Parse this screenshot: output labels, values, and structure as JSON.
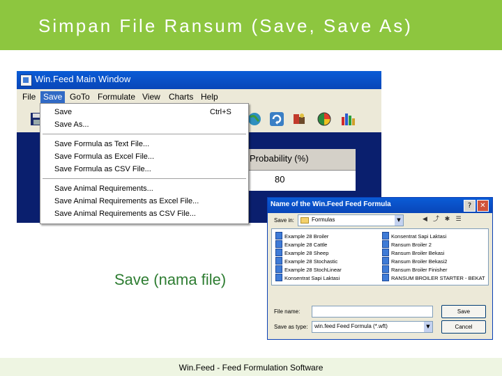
{
  "slide": {
    "title": "Simpan File Ransum (Save, Save As)",
    "caption": "Save (nama file)",
    "footer": "Win.Feed - Feed Formulation Software"
  },
  "main_window": {
    "title": "Win.Feed Main Window",
    "menu": [
      "File",
      "Save",
      "GoTo",
      "Formulate",
      "View",
      "Charts",
      "Help"
    ],
    "active_menu": "Save",
    "probability_header": "Probability (%)",
    "probability_value": "80",
    "toolbar_icons": [
      "disk-icon",
      "globe-icon",
      "refresh-icon",
      "feed-icon",
      "pie-chart-icon",
      "bar-chart-icon"
    ]
  },
  "save_menu": {
    "save": "Save",
    "save_shortcut": "Ctrl+S",
    "save_as": "Save As...",
    "formula_text": "Save Formula as Text File...",
    "formula_excel": "Save Formula as Excel File...",
    "formula_csv": "Save Formula as CSV File...",
    "animal_req": "Save Animal Requirements...",
    "animal_req_excel": "Save Animal Requirements as Excel File...",
    "animal_req_csv": "Save Animal Requirements as CSV File..."
  },
  "dialog": {
    "title": "Name of the Win.Feed Feed Formula",
    "help_btn": "?",
    "close_btn": "✕",
    "save_in_label": "Save in:",
    "save_in_value": "Formulas",
    "files_left": [
      "Example 28 Broiler",
      "Example 28 Cattle",
      "Example 28 Sheep",
      "Example 28 Stochastic",
      "Example 28 StochLinear",
      "Konsentrat Sapi Laktasi"
    ],
    "files_right": [
      "Konsentrat Sapi Laktasi",
      "Ransum Broiler 2",
      "Ransum Broiler Bekasi",
      "Ransum Broiler Bekasi2",
      "Ransum Broiler Finisher",
      "RANSUM BROILER STARTER - BEKAT"
    ],
    "filename_label": "File name:",
    "filename_value": "",
    "savetype_label": "Save as type:",
    "savetype_value": "win.feed Feed Formula (*.wft)",
    "save_button": "Save",
    "cancel_button": "Cancel"
  }
}
